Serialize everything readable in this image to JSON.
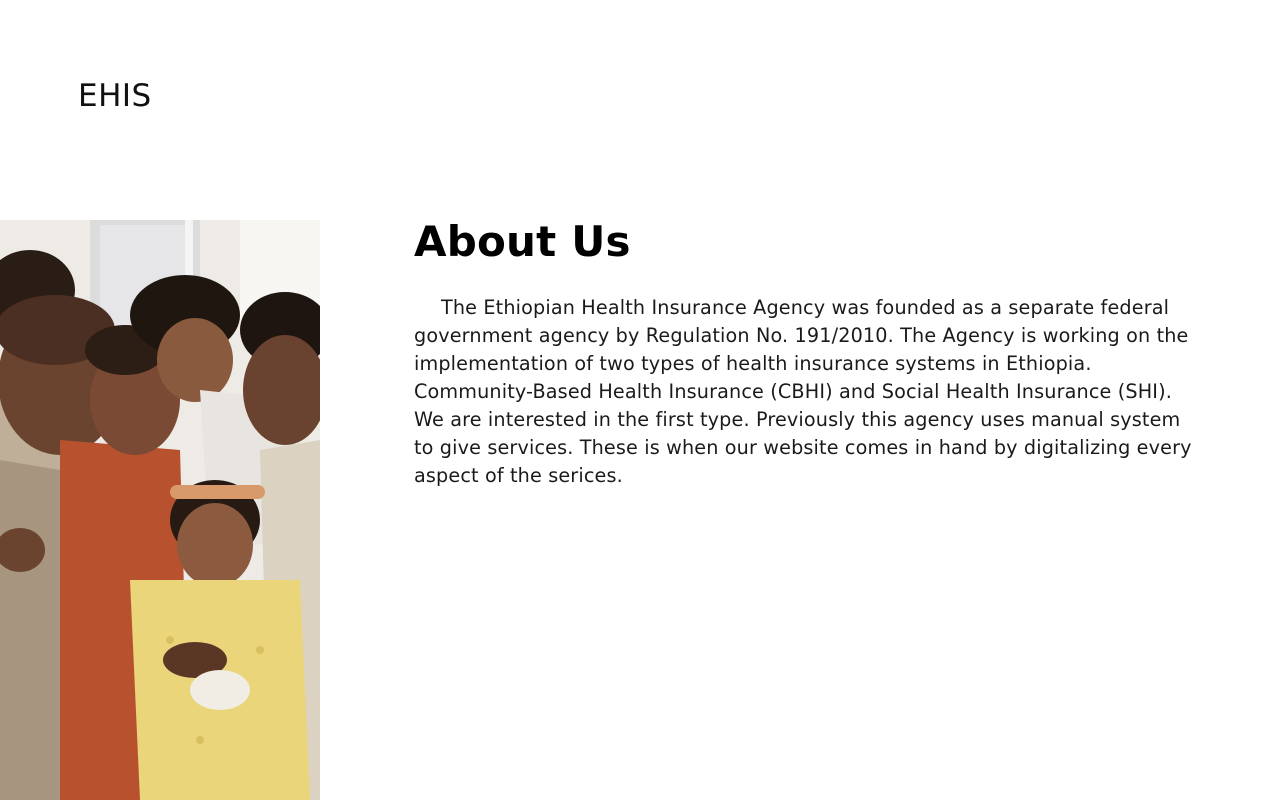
{
  "header": {
    "logo_text": "EHIS"
  },
  "hero_image": {
    "description_icon": "family-photo",
    "alt": "family"
  },
  "about": {
    "title": "About Us",
    "body": "The Ethiopian Health Insurance Agency was founded as a separate federal government agency by Regulation No. 191/2010.  The Agency is working on the implementation of two types of health insurance systems in Ethiopia. Community-Based Health Insurance (CBHI) and  Social Health Insurance (SHI). We are interested in the first type. Previously this agency uses manual system to give services. These is when our website comes in hand by digitalizing every aspect of the serices."
  },
  "colors": {
    "background": "#ffffff",
    "text": "#111111",
    "heading": "#000000"
  }
}
